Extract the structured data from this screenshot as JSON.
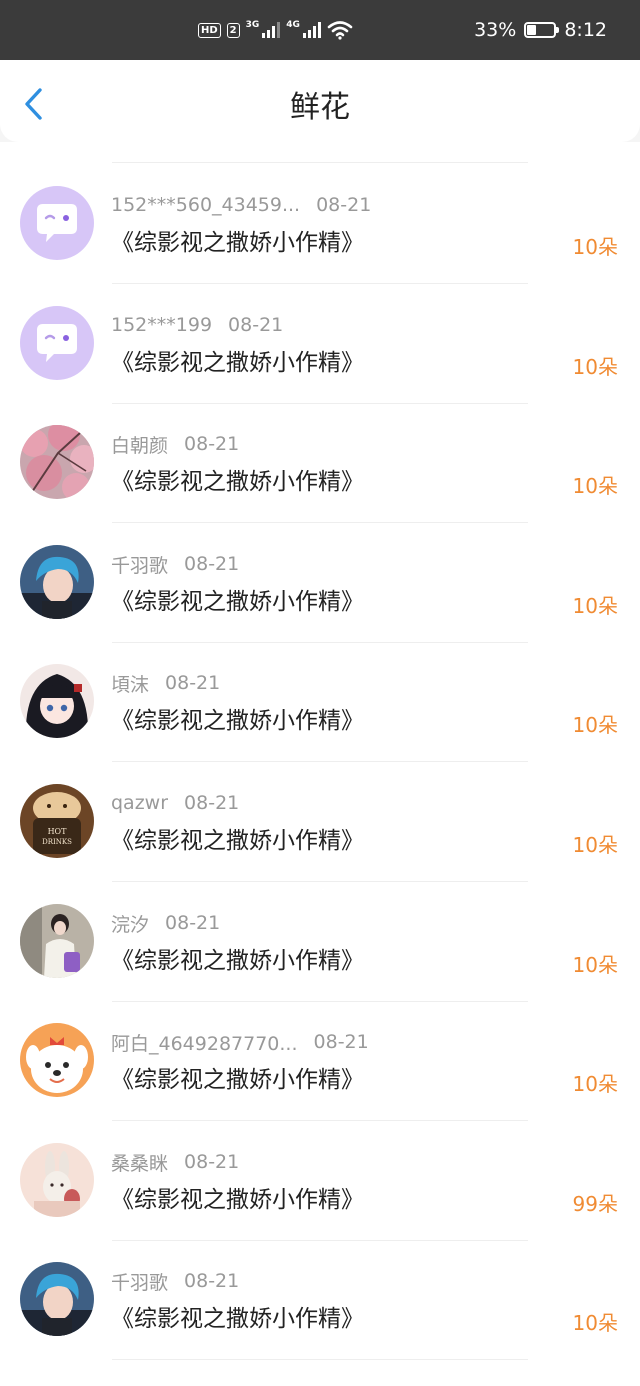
{
  "status_bar": {
    "hd_badge": "HD",
    "sim_badge": "2",
    "net1": "3G",
    "net2": "4G",
    "battery_text": "33%",
    "battery_level": 0.33,
    "time": "8:12",
    "icons": [
      "hd-icon",
      "signal-3g-icon",
      "signal-4g-icon",
      "wifi-icon",
      "battery-saver-icon"
    ]
  },
  "header": {
    "title": "鲜花",
    "back_icon": "chevron-left-icon",
    "accent_color": "#2f8fe0"
  },
  "colors": {
    "amount": "#f08b33"
  },
  "rows": [
    {
      "user": "152***560_43459...",
      "date": "08-21",
      "book": "《综影视之撒娇小作精》",
      "amount": "10朵",
      "avatar": "default-chat-bubble"
    },
    {
      "user": "152***199",
      "date": "08-21",
      "book": "《综影视之撒娇小作精》",
      "amount": "10朵",
      "avatar": "default-chat-bubble"
    },
    {
      "user": "白朝颜",
      "date": "08-21",
      "book": "《综影视之撒娇小作精》",
      "amount": "10朵",
      "avatar": "pink-blossoms"
    },
    {
      "user": "千羽歌",
      "date": "08-21",
      "book": "《综影视之撒娇小作精》",
      "amount": "10朵",
      "avatar": "blue-hair-portrait"
    },
    {
      "user": "頃沫",
      "date": "08-21",
      "book": "《综影视之撒娇小作精》",
      "amount": "10朵",
      "avatar": "anime-girl"
    },
    {
      "user": "qazwr",
      "date": "08-21",
      "book": "《综影视之撒娇小作精》",
      "amount": "10朵",
      "avatar": "hot-drinks-cat"
    },
    {
      "user": "浣汐",
      "date": "08-21",
      "book": "《综影视之撒娇小作精》",
      "amount": "10朵",
      "avatar": "girl-photo"
    },
    {
      "user": "阿白_4649287770...",
      "date": "08-21",
      "book": "《综影视之撒娇小作精》",
      "amount": "10朵",
      "avatar": "cartoon-dog"
    },
    {
      "user": "桑桑眯",
      "date": "08-21",
      "book": "《综影视之撒娇小作精》",
      "amount": "99朵",
      "avatar": "rabbit-illustration"
    },
    {
      "user": "千羽歌",
      "date": "08-21",
      "book": "《综影视之撒娇小作精》",
      "amount": "10朵",
      "avatar": "blue-hair-portrait"
    }
  ]
}
